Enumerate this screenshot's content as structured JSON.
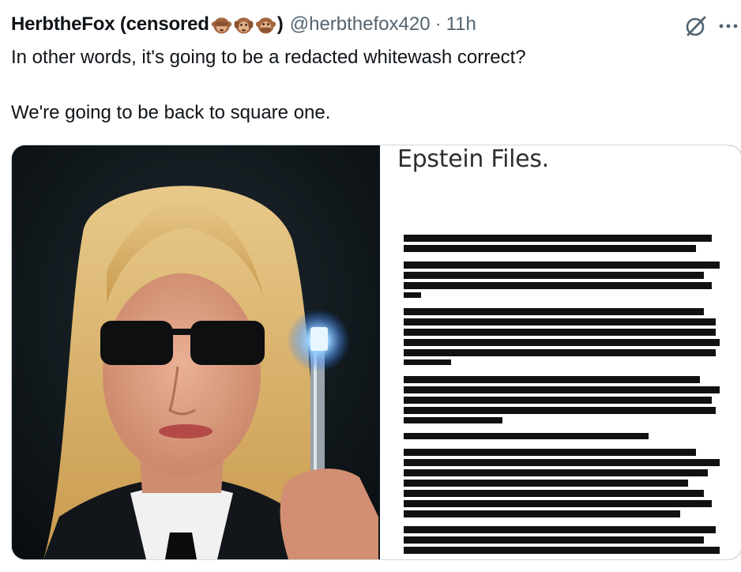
{
  "tweet": {
    "display_name": "HerbtheFox (censored",
    "paren_close": ")",
    "emojis": [
      "see-no-evil-monkey",
      "hear-no-evil-monkey",
      "speak-no-evil-monkey"
    ],
    "handle": "@herbthefox420",
    "separator": "·",
    "time": "11h",
    "text_line1": "In other words, it's going to be a redacted whitewash correct?",
    "text_line2": "We're going to be back to square one."
  },
  "actions": {
    "grok_icon": "grok-slash-icon",
    "more_icon": "more-options-icon"
  },
  "media": {
    "left_image": "woman-in-sunglasses-holding-glowing-device",
    "right_image": {
      "title": "Epstein Files."
    }
  },
  "colors": {
    "text": "#0f1419",
    "secondary": "#536471",
    "border": "#cfd9de"
  }
}
